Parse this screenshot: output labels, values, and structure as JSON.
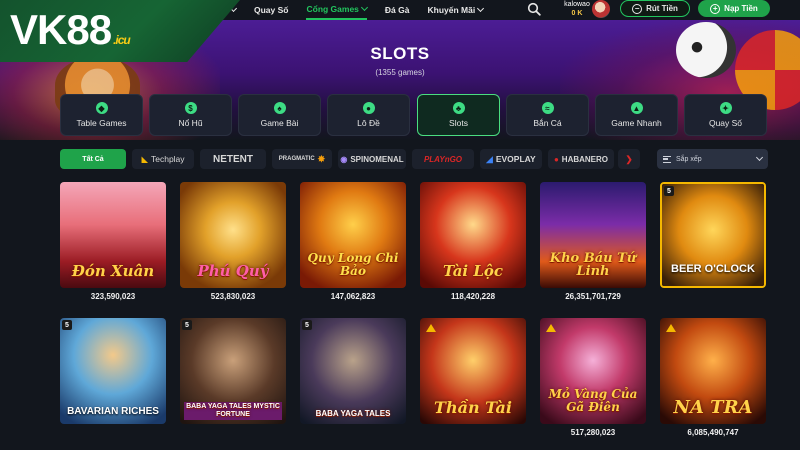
{
  "brand": {
    "logo_main": "VK88",
    "logo_suffix": ".icu"
  },
  "nav": {
    "items": [
      {
        "label": "",
        "active": false,
        "dropdown": true
      },
      {
        "label": "Quay Số",
        "active": false,
        "dropdown": false
      },
      {
        "label": "Cổng Games",
        "active": true,
        "dropdown": true
      },
      {
        "label": "Đá Gà",
        "active": false,
        "dropdown": false
      },
      {
        "label": "Khuyến Mãi",
        "active": false,
        "dropdown": true
      }
    ]
  },
  "account": {
    "username": "kalowao",
    "balance": "0 K"
  },
  "buttons": {
    "withdraw": "Rút Tiền",
    "deposit": "Nạp Tiền"
  },
  "hero": {
    "title": "SLOTS",
    "subtitle": "(1355 games)"
  },
  "categories": [
    {
      "label": "Table Games",
      "icon": "table-games-icon",
      "active": false
    },
    {
      "label": "Nổ Hũ",
      "icon": "jackpot-icon",
      "active": false
    },
    {
      "label": "Game Bài",
      "icon": "cards-icon",
      "active": false
    },
    {
      "label": "Lô Đề",
      "icon": "lottery-ball-icon",
      "active": false
    },
    {
      "label": "Slots",
      "icon": "cherry-icon",
      "active": true
    },
    {
      "label": "Bắn Cá",
      "icon": "fish-icon",
      "active": false
    },
    {
      "label": "Game Nhanh",
      "icon": "rocket-icon",
      "active": false
    },
    {
      "label": "Quay Số",
      "icon": "spin-icon",
      "active": false
    }
  ],
  "providers": {
    "all": "Tất Cả",
    "items": [
      "Techplay",
      "NETENT",
      "PRAGMATIC",
      "SPINOMENAL",
      "PLAYnGO",
      "EVOPLAY",
      "HABANERO"
    ],
    "sort_label": "Sắp xếp"
  },
  "games_row1": [
    {
      "name": "Đón Xuân",
      "jackpot": "323,590,023",
      "badge": ""
    },
    {
      "name": "Phú Quý",
      "jackpot": "523,830,023",
      "badge": ""
    },
    {
      "name": "Quy Long Chi Bảo",
      "jackpot": "147,062,823",
      "badge": ""
    },
    {
      "name": "Tài Lộc",
      "jackpot": "118,420,228",
      "badge": ""
    },
    {
      "name": "Kho Báu Tứ Linh",
      "jackpot": "26,351,701,729",
      "badge": ""
    },
    {
      "name": "BEER O'CLOCK",
      "jackpot": "",
      "badge": "5"
    }
  ],
  "games_row2": [
    {
      "name": "BAVARIAN RICHES",
      "jackpot": "",
      "badge": "5"
    },
    {
      "name": "BABA YAGA TALES MYSTIC FORTUNE",
      "jackpot": "",
      "badge": "5"
    },
    {
      "name": "BABA YAGA TALES",
      "jackpot": "",
      "badge": "5"
    },
    {
      "name": "Thần Tài",
      "jackpot": "",
      "badge": ""
    },
    {
      "name": "Mỏ Vàng Của Gã Điên",
      "jackpot": "517,280,023",
      "badge": ""
    },
    {
      "name": "NA TRA",
      "jackpot": "6,085,490,747",
      "badge": ""
    }
  ],
  "colors": {
    "accent": "#1fa34a",
    "gold": "#f7c948",
    "bg": "#12161d"
  }
}
